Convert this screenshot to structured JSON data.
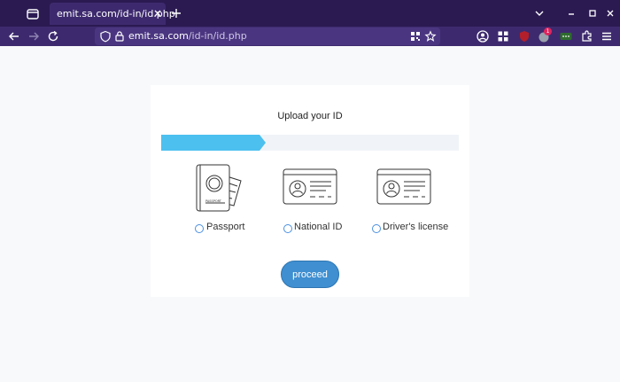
{
  "browser": {
    "tab": {
      "title": "emit.sa.com/id-in/id.php"
    },
    "url": {
      "host": "emit.sa.com",
      "path": "/id-in/id.php"
    },
    "extensions": {
      "notification_count": "1"
    }
  },
  "page": {
    "title": "Upload your ID",
    "progress": {
      "fraction": 0.35
    },
    "options": [
      {
        "label": "Passport",
        "selected": false
      },
      {
        "label": "National ID",
        "selected": false
      },
      {
        "label": "Driver's license",
        "selected": false
      }
    ],
    "proceed_label": "proceed"
  },
  "colors": {
    "tab_bar": "#2b1a52",
    "toolbar": "#3d2a6e",
    "progress_fill": "#4cc0ef",
    "button": "#3f8fd1"
  }
}
